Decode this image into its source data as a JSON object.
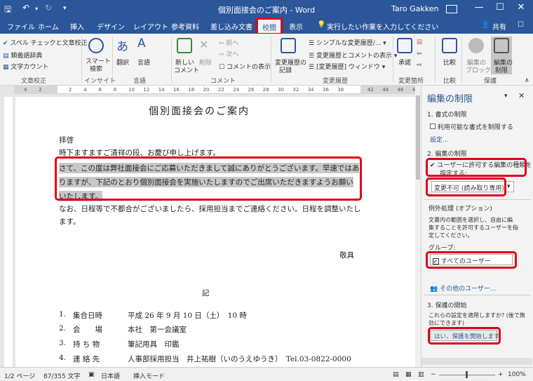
{
  "titlebar": {
    "title": "個別面接会のご案内 - Word",
    "user": "Taro Gakken"
  },
  "tabs": [
    "ファイル",
    "ホーム",
    "挿入",
    "デザイン",
    "レイアウト",
    "参考資料",
    "差し込み文書",
    "校閲",
    "表示"
  ],
  "tell_me": "実行したい作業を入力してください",
  "share": "共有",
  "ribbon": {
    "spell": "スペル チェックと文章校正",
    "thesaurus": "類義語辞典",
    "wordcount": "文字カウント",
    "group_proof": "文章校正",
    "smart": "スマート",
    "smart2": "検索",
    "group_insight": "インサイト",
    "translate": "翻訳",
    "language": "言語",
    "group_language": "言語",
    "newcomment": "新しい",
    "newcomment2": "コメント",
    "delete": "削除",
    "prev": "前へ",
    "next": "次へ",
    "showcomments": "コメントの表示",
    "group_comment": "コメント",
    "track": "変更履歴の",
    "track2": "記録",
    "markup_simple": "シンプルな変更履歴/...",
    "markup_show": "変更履歴とコメントの表示",
    "reviewpane": "[変更履歴] ウィンドウ",
    "group_track": "変更履歴",
    "accept": "承諾",
    "group_changes": "変更箇所",
    "compare": "比較",
    "group_compare": "比較",
    "blockauthors": "編集の",
    "blockauthors2": "ブロック",
    "restrict": "編集の",
    "restrict2": "制限",
    "group_protect": "保護"
  },
  "ruler_nums": [
    "4",
    "2",
    "",
    "2",
    "4",
    "6",
    "8",
    "10",
    "12",
    "14",
    "16",
    "18",
    "20",
    "22",
    "24",
    "26",
    "28",
    "30",
    "32",
    "34",
    "36",
    "38",
    "",
    "42",
    "44",
    "46",
    "48"
  ],
  "doc": {
    "title": "個別面接会のご案内",
    "haikei": "拝啓",
    "line_greet": "時下ますますご清祥の段、お慶び申し上げます。",
    "hl1": "さて、この度は弊社面接会にご応募いただきまして誠にありがとうございます。早速ではあ",
    "hl2": "りますが、下記のとおり個別面接会を実施いたしますのでご出席いただきますようお願い",
    "hl3": "いたします。",
    "p2a": "なお、日程等で不都合がございましたら、採用担当までご連絡ください。日程を調整いたし",
    "p2b": "ます。",
    "keigu": "敬具",
    "ki": "記",
    "items": [
      {
        "num": "1.",
        "label": "集合日時",
        "value": "平成 26 年 9 月 10 日（土）　10 時"
      },
      {
        "num": "2.",
        "label": "会　　場",
        "value": "本社　第一会議室"
      },
      {
        "num": "3.",
        "label": "持 ち 物",
        "value": "筆記用具　印鑑"
      },
      {
        "num": "4.",
        "label": "連 絡 先",
        "value": "人事部採用担当　井上祐樹（いのうえゆうき）　Tel.03-0822-0000"
      }
    ]
  },
  "pane": {
    "title": "編集の制限",
    "s1": "1. 書式の制限",
    "s1_check": "利用可能な書式を制限する",
    "s1_link": "設定...",
    "s2": "2. 編集の制限",
    "s2_check_a": "ユーザーに許可する編集の種類を",
    "s2_check_b": "指定する:",
    "s2_select": "変更不可 (読み取り専用)",
    "exc": "例外処理 (オプション)",
    "exc_desc1": "文書内の範囲を選択し、自由に編",
    "exc_desc2": "集することを許可するユーザーを指",
    "exc_desc3": "定してください。",
    "group_label": "グループ:",
    "everyone": "すべてのユーザー",
    "more_users": "その他のユーザー...",
    "s3": "3. 保護の開始",
    "s3_desc1": "これらの設定を適用しますか? (後で無",
    "s3_desc2": "効にできます)",
    "start_btn": "はい、保護を開始します"
  },
  "status": {
    "page": "1/2 ページ",
    "words": "87/355 文字",
    "lang": "日本語",
    "mode": "挿入モード",
    "zoom": "100%"
  },
  "colors": {
    "accent": "#2b579a",
    "highlight_box": "#e0001a"
  }
}
